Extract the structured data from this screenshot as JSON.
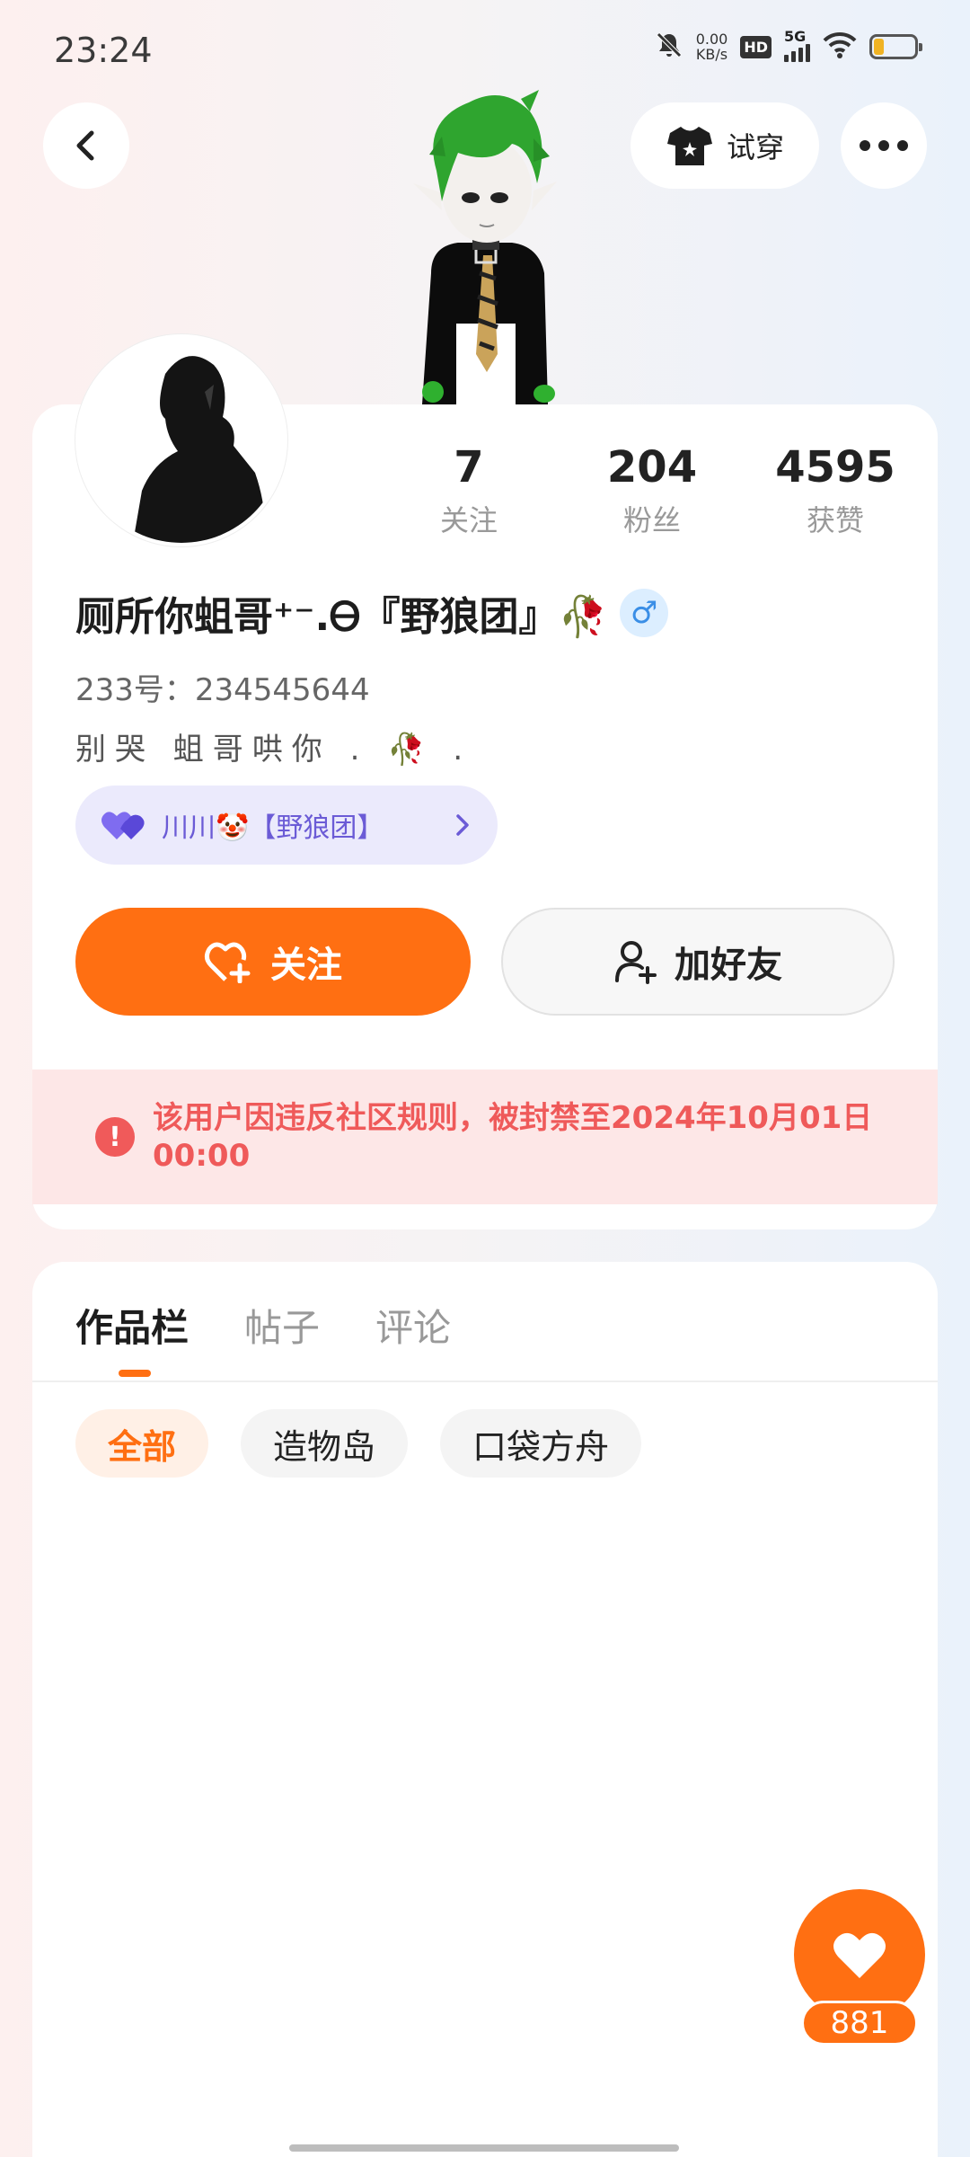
{
  "status_bar": {
    "time": "23:24",
    "net_speed_value": "0.00",
    "net_speed_unit": "KB/s",
    "hd": "HD",
    "network": "5G",
    "battery_level": 0.25,
    "icons": [
      "mute-icon",
      "hd-icon",
      "signal-icon",
      "wifi-icon",
      "battery-icon"
    ]
  },
  "nav": {
    "back_icon": "chevron-left-icon",
    "tryon_label": "试穿",
    "tryon_icon": "shirt-icon",
    "more_icon": "more-dots-icon"
  },
  "profile": {
    "stats": [
      {
        "value": "7",
        "label": "关注"
      },
      {
        "value": "204",
        "label": "粉丝"
      },
      {
        "value": "4595",
        "label": "获赞"
      }
    ],
    "nickname": "厕所你蛆哥⁺⁻.Ꮎ『野狼团』🥀",
    "gender_symbol": "♂",
    "uid": "233号：234545644",
    "bio": "别哭 蛆哥哄你 . 🥀 .",
    "cp_label": "川川🤡【野狼团】",
    "follow_label": "关注",
    "add_friend_label": "加好友",
    "ban_notice": "该用户因违反社区规则，被封禁至2024年10月01日 00:00"
  },
  "works": {
    "tabs": [
      "作品栏",
      "帖子",
      "评论"
    ],
    "active_tab": "作品栏",
    "filters": [
      "全部",
      "造物岛",
      "口袋方舟"
    ],
    "active_filter": "全部"
  },
  "fab": {
    "like_count": "881"
  },
  "colors": {
    "accent": "#ff6f12",
    "ban_text": "#ef5a5a",
    "ban_bg": "#fde7e7",
    "cp_text": "#6b5bd6"
  }
}
